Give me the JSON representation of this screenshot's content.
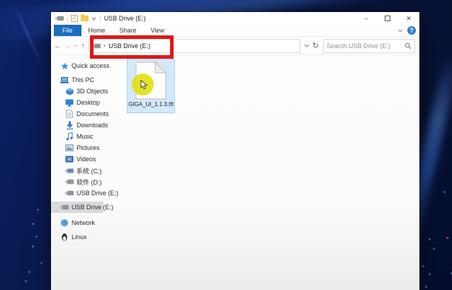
{
  "window": {
    "title": "USB Drive (E:)",
    "controls": {
      "minimize": "–",
      "close": "✕"
    }
  },
  "ribbon": {
    "tabs": {
      "file": "File",
      "home": "Home",
      "share": "Share",
      "view": "View"
    },
    "help": "?"
  },
  "navbar": {
    "icons": {
      "back": "←",
      "forward": "→",
      "up": "↑",
      "refresh": "↻",
      "crumb_sep": "›"
    },
    "breadcrumb": "USB Drive (E:)",
    "search": {
      "placeholder": "Search USB Drive (E:)"
    }
  },
  "sidebar": {
    "items": [
      {
        "label": "Quick access"
      },
      {
        "label": "This PC"
      },
      {
        "label": "3D Objects"
      },
      {
        "label": "Desktop"
      },
      {
        "label": "Documents"
      },
      {
        "label": "Downloads"
      },
      {
        "label": "Music"
      },
      {
        "label": "Pictures"
      },
      {
        "label": "Videos"
      },
      {
        "label": "系统 (C:)"
      },
      {
        "label": "软件 (D:)"
      },
      {
        "label": "USB Drive (E:)"
      },
      {
        "label": "USB Drive (E:)",
        "selected": true
      },
      {
        "label": "Network"
      },
      {
        "label": "Linux"
      }
    ]
  },
  "content": {
    "file": {
      "name": "GIGA_UI_1.1.3.tft",
      "selected": true
    }
  },
  "colors": {
    "file_tab_blue": "#1d6ebe",
    "annotation_red": "#e01616",
    "selection_blue": "#d2e9fa",
    "click_highlight_yellow": "#e2de14",
    "desktop_navy": "#0a1b52"
  }
}
